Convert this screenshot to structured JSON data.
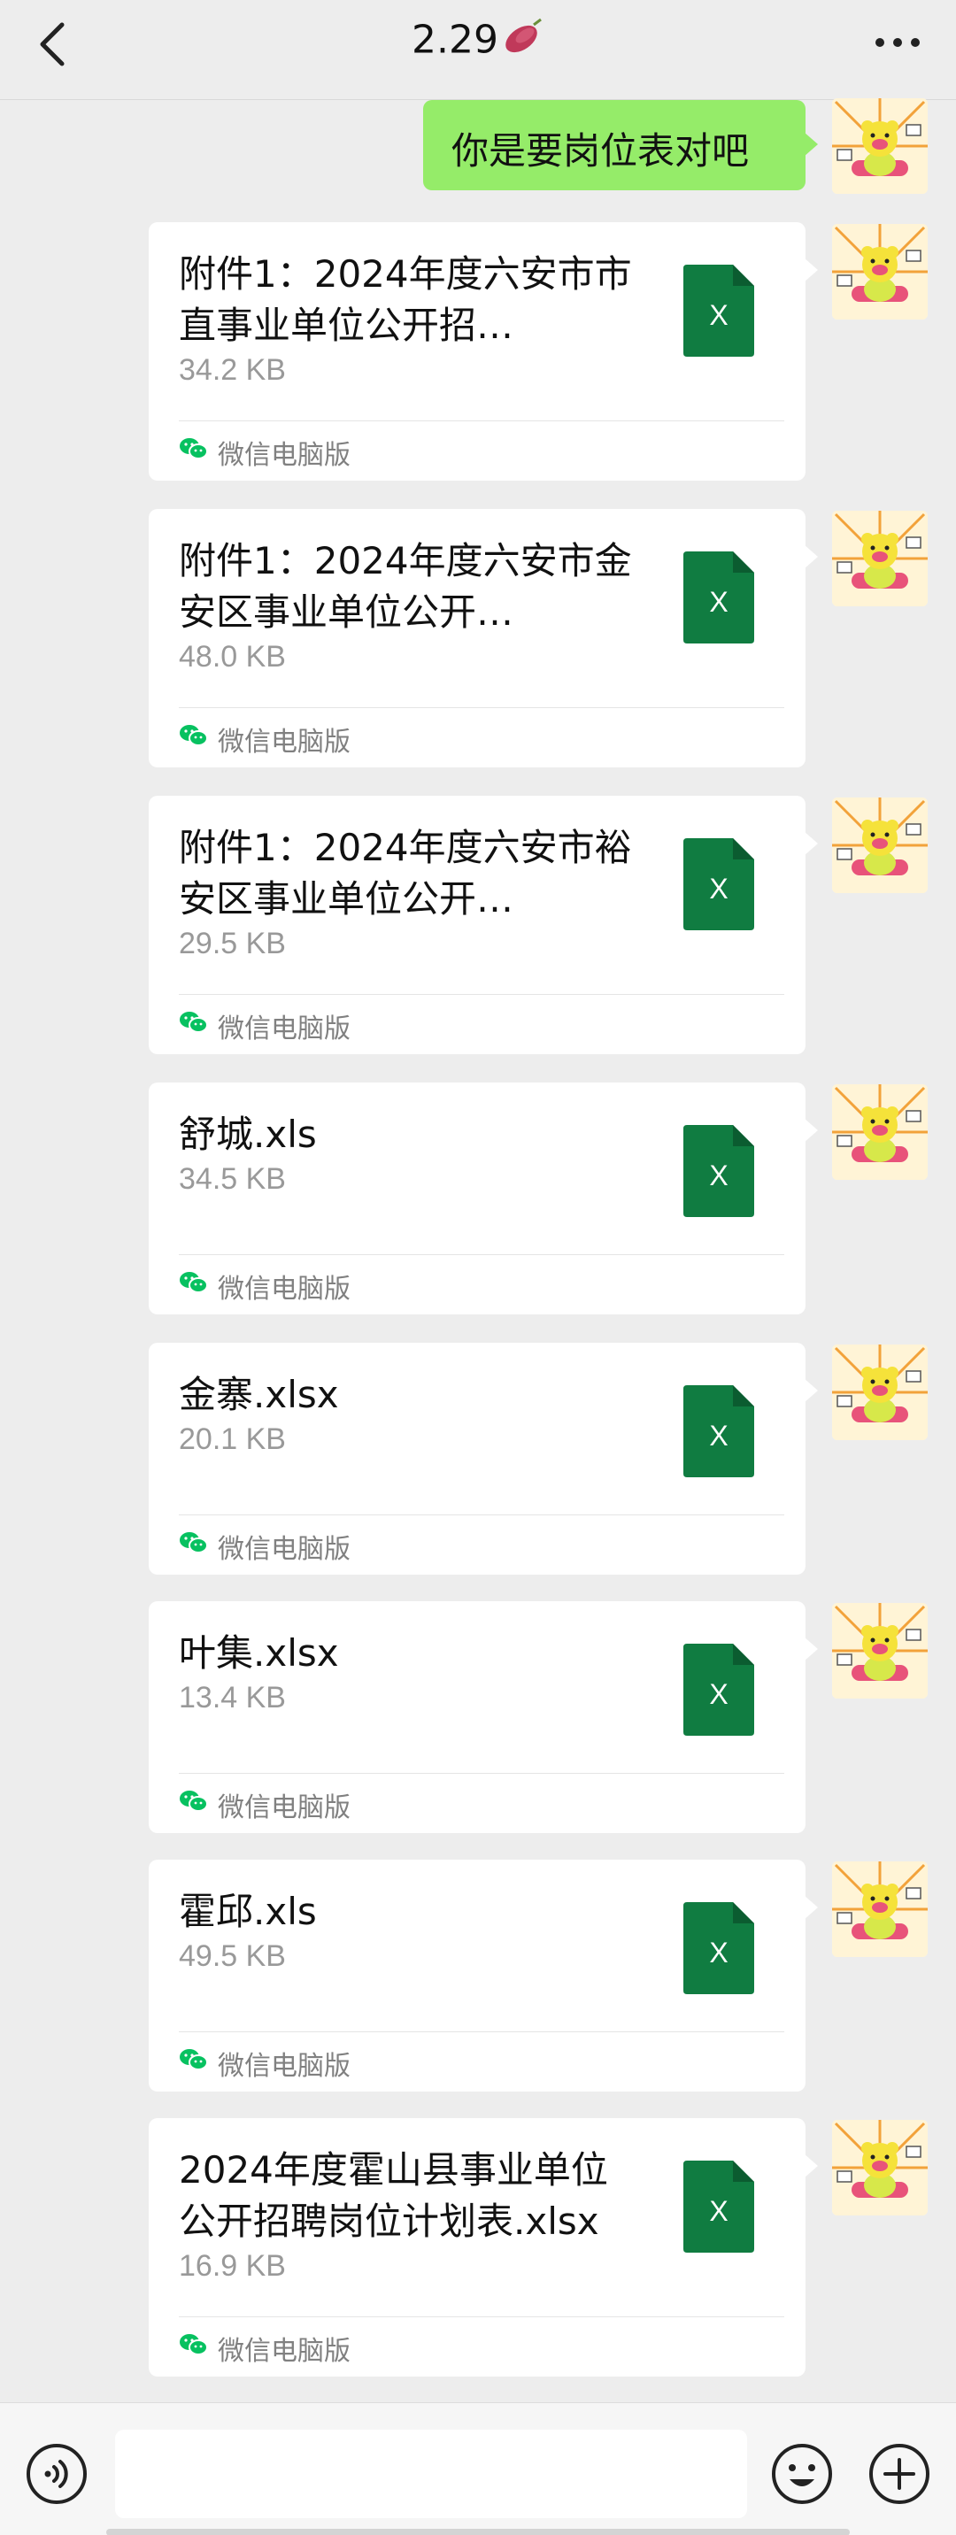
{
  "header": {
    "title": "2.29",
    "back_icon": "chevron-left-icon",
    "more_icon": "more-dots-icon",
    "title_emoji": "sweet-potato-emoji"
  },
  "messages": {
    "text_message": "你是要岗位表对吧",
    "source_label": "微信电脑版",
    "file_icon_letter": "X",
    "files": [
      {
        "name": "附件1：2024年度六安市市直事业单位公开招…",
        "size": "34.2 KB"
      },
      {
        "name": "附件1：2024年度六安市金安区事业单位公开…",
        "size": "48.0 KB"
      },
      {
        "name": "附件1：2024年度六安市裕安区事业单位公开…",
        "size": "29.5 KB"
      },
      {
        "name": "舒城.xls",
        "size": "34.5 KB"
      },
      {
        "name": "金寨.xlsx",
        "size": "20.1 KB"
      },
      {
        "name": "叶集.xlsx",
        "size": "13.4 KB"
      },
      {
        "name": "霍邱.xls",
        "size": "49.5 KB"
      },
      {
        "name": "2024年度霍山县事业单位公开招聘岗位计划表.xlsx",
        "size": "16.9 KB"
      }
    ]
  },
  "inputbar": {
    "voice_icon": "voice-icon",
    "emoji_icon": "emoji-icon",
    "plus_icon": "plus-icon"
  },
  "colors": {
    "background": "#ededed",
    "bubble_green": "#95ec69",
    "excel_green": "#107c41"
  }
}
